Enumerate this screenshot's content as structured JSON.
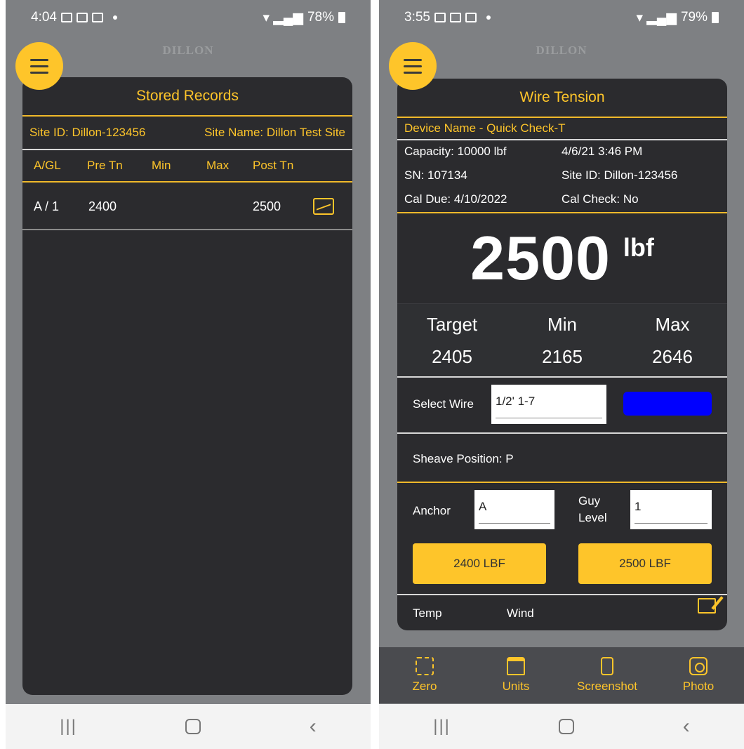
{
  "left": {
    "status": {
      "time": "4:04",
      "battery": "78%"
    },
    "brand": "DILLON",
    "card_title": "Stored Records",
    "site_id": "Site ID: Dillon-123456",
    "site_name": "Site Name: Dillon Test Site",
    "columns": [
      "A/GL",
      "Pre Tn",
      "Min",
      "Max",
      "Post Tn"
    ],
    "records": [
      {
        "agl": "A / 1",
        "pre_tn": "2400",
        "min": "",
        "max": "",
        "post_tn": "2500",
        "icon": "image-icon"
      }
    ]
  },
  "right": {
    "status": {
      "time": "3:55",
      "battery": "79%"
    },
    "brand": "DILLON",
    "card_title": "Wire Tension",
    "device_name": "Device Name  -  Quick Check-T",
    "info": {
      "capacity": "Capacity: 10000 lbf",
      "datetime": "4/6/21 3:46 PM",
      "sn": "SN: 107134",
      "site_id": "Site ID: Dillon-123456",
      "cal_due": "Cal Due:  4/10/2022",
      "cal_check": "Cal Check: No"
    },
    "reading": {
      "value": "2500",
      "unit": "lbf"
    },
    "target_label": "Target",
    "min_label": "Min",
    "max_label": "Max",
    "target_value": "2405",
    "min_value": "2165",
    "max_value": "2646",
    "select_wire_label": "Select Wire",
    "select_wire_value": "1/2' 1-7",
    "wire_color": "#0000ff",
    "sheave_position": "Sheave Position:  P",
    "anchor_label": "Anchor",
    "anchor_value": "A",
    "guy_level_label_1": "Guy",
    "guy_level_label_2": "Level",
    "guy_level_value": "1",
    "pre_button": "2400 LBF",
    "post_button": "2500 LBF",
    "temp_label": "Temp",
    "wind_label": "Wind",
    "toolbar": [
      {
        "label": "Zero",
        "icon": "zero-icon"
      },
      {
        "label": "Units",
        "icon": "weight-icon"
      },
      {
        "label": "Screenshot",
        "icon": "phone-icon"
      },
      {
        "label": "Photo",
        "icon": "camera-icon"
      }
    ]
  },
  "colors": {
    "accent": "#fec52a",
    "card": "#2b2b2e",
    "background": "#7e8083",
    "toolbar": "#4a4b4f"
  }
}
